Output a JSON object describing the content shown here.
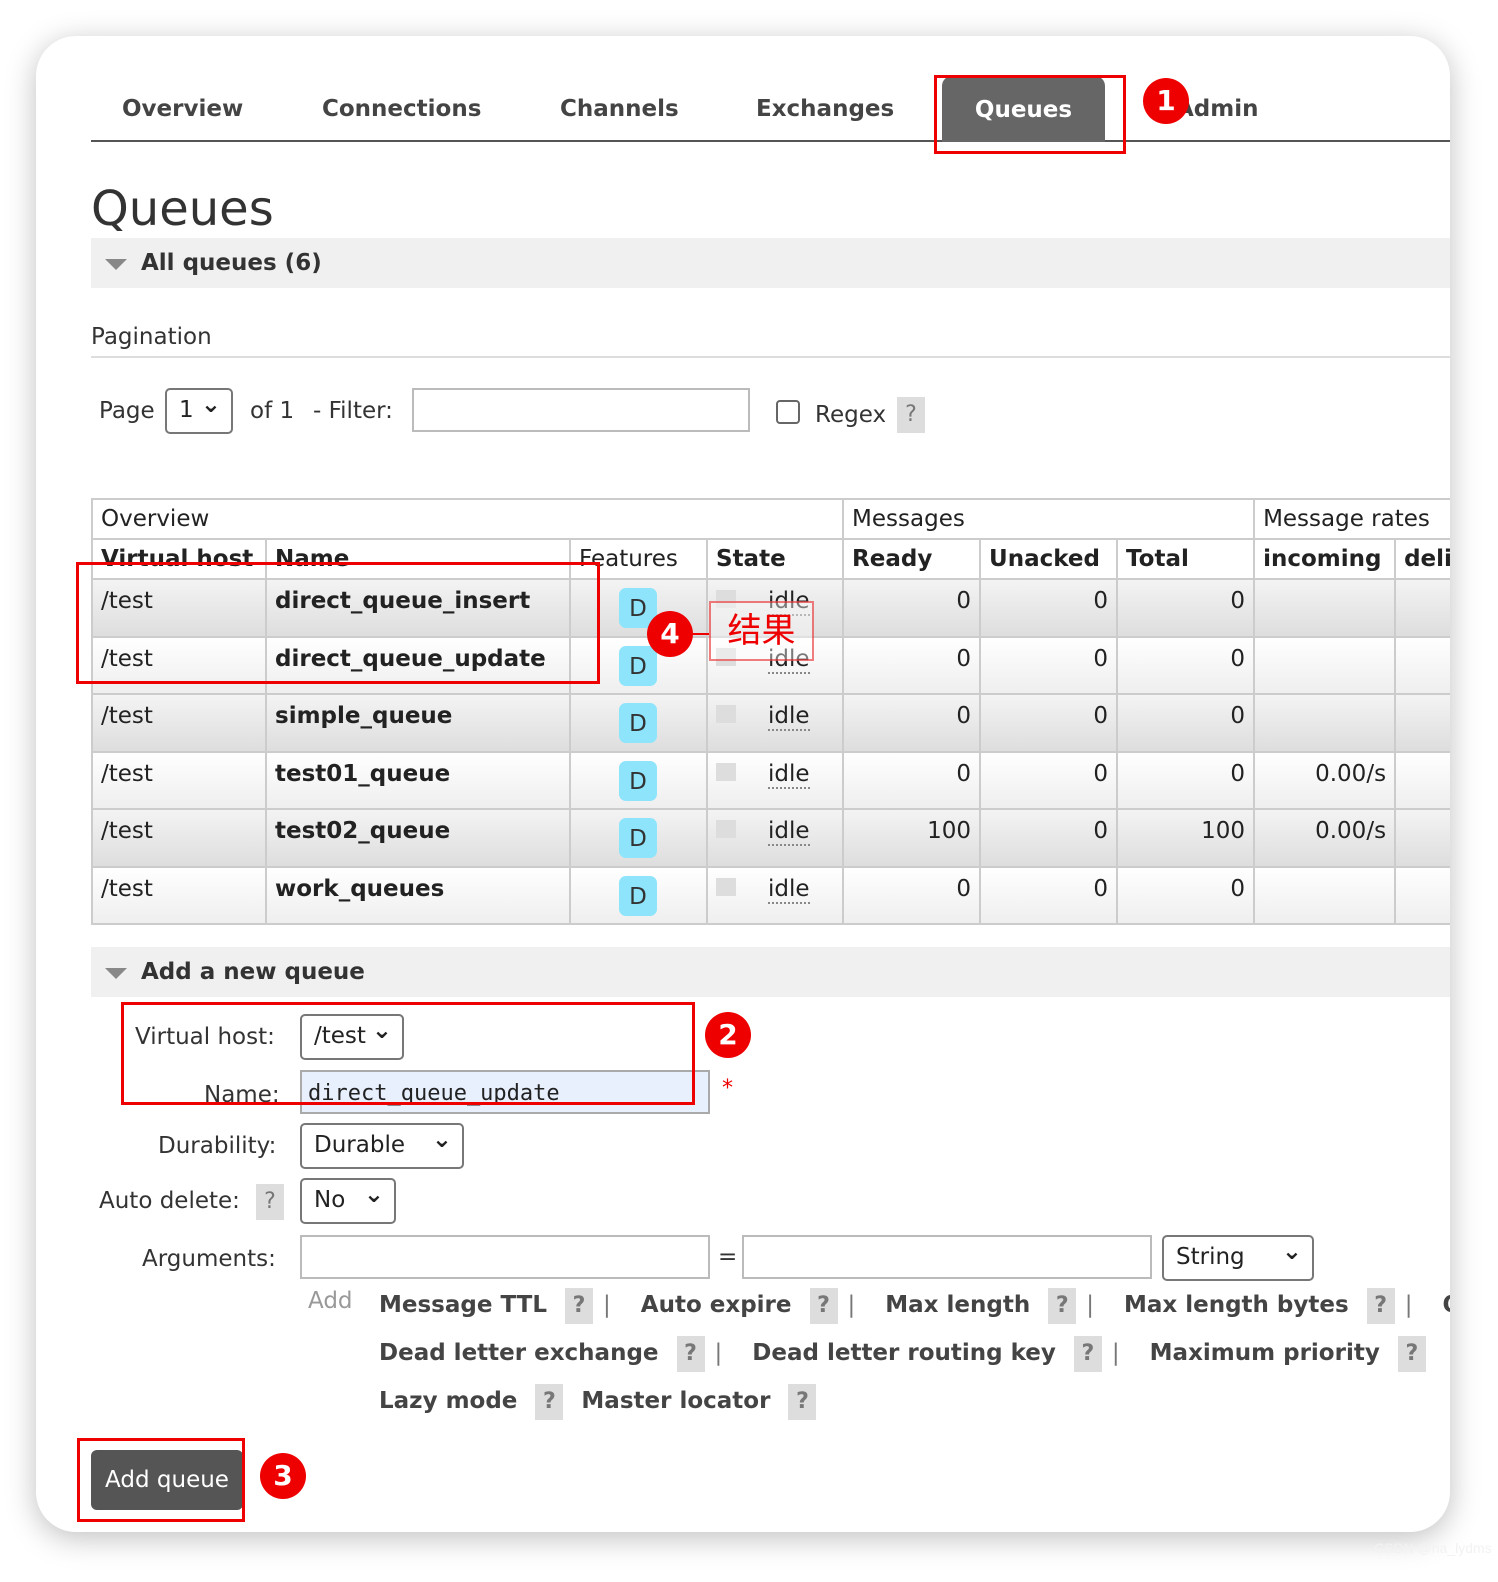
{
  "nav": {
    "tabs": [
      "Overview",
      "Connections",
      "Channels",
      "Exchanges",
      "Queues",
      "Admin"
    ],
    "active": "Queues",
    "admin_visible": "min"
  },
  "page_title": "Queues",
  "all_queues": {
    "label": "All queues (6)"
  },
  "pagination": {
    "title": "Pagination",
    "page_label": "Page",
    "page_value": "1",
    "of_label": "of 1",
    "filter_label": "- Filter:",
    "filter_value": "",
    "regex_label": "Regex",
    "help": "?"
  },
  "table": {
    "group_headers": [
      "Overview",
      "Messages",
      "Message rates"
    ],
    "columns": [
      "Virtual host",
      "Name",
      "Features",
      "State",
      "Ready",
      "Unacked",
      "Total",
      "incoming",
      "deli"
    ],
    "rows": [
      {
        "vhost": "/test",
        "name": "direct_queue_insert",
        "feature": "D",
        "state": "idle",
        "ready": "0",
        "unacked": "0",
        "total": "0",
        "incoming": ""
      },
      {
        "vhost": "/test",
        "name": "direct_queue_update",
        "feature": "D",
        "state": "idle",
        "ready": "0",
        "unacked": "0",
        "total": "0",
        "incoming": ""
      },
      {
        "vhost": "/test",
        "name": "simple_queue",
        "feature": "D",
        "state": "idle",
        "ready": "0",
        "unacked": "0",
        "total": "0",
        "incoming": ""
      },
      {
        "vhost": "/test",
        "name": "test01_queue",
        "feature": "D",
        "state": "idle",
        "ready": "0",
        "unacked": "0",
        "total": "0",
        "incoming": "0.00/s"
      },
      {
        "vhost": "/test",
        "name": "test02_queue",
        "feature": "D",
        "state": "idle",
        "ready": "100",
        "unacked": "0",
        "total": "100",
        "incoming": "0.00/s"
      },
      {
        "vhost": "/test",
        "name": "work_queues",
        "feature": "D",
        "state": "idle",
        "ready": "0",
        "unacked": "0",
        "total": "0",
        "incoming": ""
      }
    ]
  },
  "add_queue": {
    "title": "Add a new queue",
    "vhost_label": "Virtual host:",
    "vhost_value": "/test",
    "name_label": "Name:",
    "name_value": "direct_queue_update",
    "required": "*",
    "durability_label": "Durability:",
    "durability_value": "Durable",
    "auto_delete_label": "Auto delete:",
    "auto_delete_value": "No",
    "arguments_label": "Arguments:",
    "equals": "=",
    "arg_type": "String",
    "add_label": "Add",
    "arg_links": [
      "Message TTL",
      "Auto expire",
      "Max length",
      "Max length bytes",
      "Ov",
      "Dead letter exchange",
      "Dead letter routing key",
      "Maximum priority",
      "Lazy mode",
      "Master locator"
    ],
    "submit": "Add queue"
  },
  "annotations": {
    "markers": [
      "1",
      "2",
      "3",
      "4"
    ],
    "result_label": "结果",
    "color": "#e00000"
  },
  "watermark": "CSDN @ha_lydms"
}
